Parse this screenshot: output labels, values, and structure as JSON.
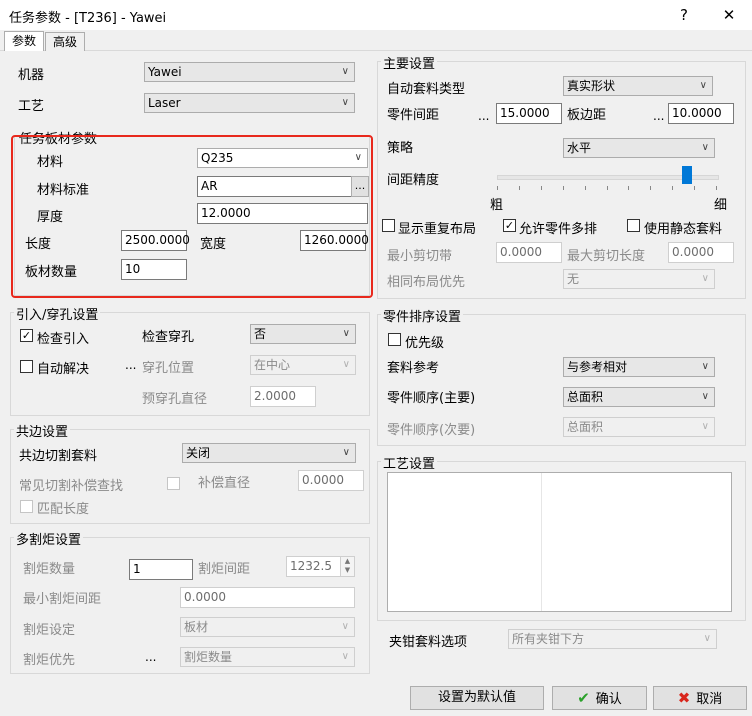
{
  "window": {
    "title": "任务参数 - [T236] - Yawei",
    "help": "?",
    "close": "✕"
  },
  "tabs": [
    {
      "label": "参数"
    },
    {
      "label": "高级"
    }
  ],
  "machine": {
    "label": "机器",
    "value": "Yawei"
  },
  "process": {
    "label": "工艺",
    "value": "Laser"
  },
  "task_sheet": {
    "title": "任务板材参数",
    "material_label": "材料",
    "material_value": "Q235",
    "material_std_label": "材料标准",
    "material_std_value": "AR",
    "material_std_btn": "...",
    "thickness_label": "厚度",
    "thickness_value": "12.0000",
    "length_label": "长度",
    "length_value": "2500.0000",
    "width_label": "宽度",
    "width_value": "1260.0000",
    "count_label": "板材数量",
    "count_value": "10"
  },
  "leadin": {
    "title": "引入/穿孔设置",
    "check_leadin": "检查引入",
    "check_pierce": "检查穿孔",
    "check_pierce_value": "否",
    "auto_resolve": "自动解决",
    "dots": "...",
    "pierce_pos_label": "穿孔位置",
    "pierce_pos_value": "在中心",
    "prepierce_label": "预穿孔直径",
    "prepierce_value": "2.0000"
  },
  "common": {
    "title": "共边设置",
    "cut_nest_label": "共边切割套料",
    "cut_nest_value": "关闭",
    "comp_label": "常见切割补偿查找",
    "comp_dia_label": "补偿直径",
    "comp_dia_value": "0.0000",
    "match_len": "匹配长度"
  },
  "multi_torch": {
    "title": "多割炬设置",
    "count_label": "割炬数量",
    "count_value": "1",
    "spacing_label": "割炬间距",
    "spacing_value": "1232.5",
    "min_spacing_label": "最小割炬间距",
    "min_spacing_value": "0.0000",
    "setting_label": "割炬设定",
    "setting_value": "板材",
    "priority_label": "割炬优先",
    "priority_dots": "...",
    "priority_value": "割炬数量"
  },
  "main": {
    "title": "主要设置",
    "auto_nest_label": "自动套料类型",
    "auto_nest_value": "真实形状",
    "part_gap_label": "零件间距",
    "part_gap_dots": "...",
    "part_gap_value": "15.0000",
    "edge_gap_label": "板边距",
    "edge_gap_dots": "...",
    "edge_gap_value": "10.0000",
    "strategy_label": "策略",
    "strategy_value": "水平",
    "precision_label": "间距精度",
    "precision_coarse": "粗",
    "precision_fine": "细",
    "precision_level": 0.88,
    "show_repeat": "显示重复布局",
    "allow_multi": "允许零件多排",
    "static_nest": "使用静态套料",
    "min_cut_label": "最小剪切带",
    "min_cut_value": "0.0000",
    "max_cut_label": "最大剪切长度",
    "max_cut_value": "0.0000",
    "same_layout_label": "相同布局优先",
    "same_layout_value": "无"
  },
  "sort": {
    "title": "零件排序设置",
    "priority": "优先级",
    "ref_label": "套料参考",
    "ref_value": "与参考相对",
    "order_main_label": "零件顺序(主要)",
    "order_main_value": "总面积",
    "order_sub_label": "零件顺序(次要)",
    "order_sub_value": "总面积"
  },
  "craft": {
    "title": "工艺设置"
  },
  "clamp": {
    "label": "夹钳套料选项",
    "value": "所有夹钳下方"
  },
  "footer": {
    "default_btn": "设置为默认值",
    "ok_btn": "确认",
    "cancel_btn": "取消"
  },
  "colors": {
    "accent": "#0078d7",
    "highlight": "#e8281c",
    "ok": "#2aa12a",
    "cancel": "#d9261c"
  }
}
